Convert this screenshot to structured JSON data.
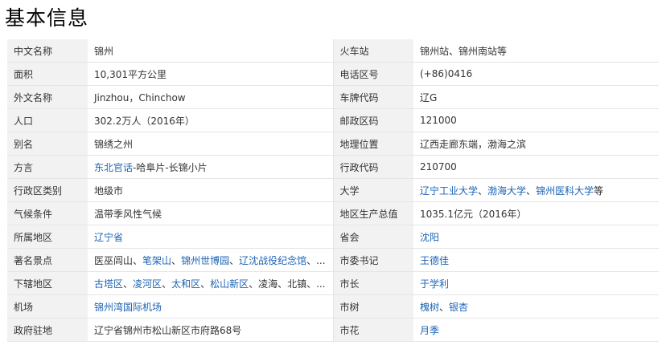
{
  "title": "基本信息",
  "rows": [
    [
      {
        "label": "中文名称",
        "value": [
          {
            "t": "锦州"
          }
        ]
      },
      {
        "label": "火车站",
        "value": [
          {
            "t": "锦州站、锦州南站等"
          }
        ]
      }
    ],
    [
      {
        "label": "面积",
        "value": [
          {
            "t": "10,301平方公里"
          }
        ]
      },
      {
        "label": "电话区号",
        "value": [
          {
            "t": "(+86)0416"
          }
        ]
      }
    ],
    [
      {
        "label": "外文名称",
        "value": [
          {
            "t": "Jinzhou，Chinchow"
          }
        ]
      },
      {
        "label": "车牌代码",
        "value": [
          {
            "t": "辽G"
          }
        ]
      }
    ],
    [
      {
        "label": "人口",
        "value": [
          {
            "t": "302.2万人（2016年）"
          }
        ]
      },
      {
        "label": "邮政区码",
        "value": [
          {
            "t": "121000"
          }
        ]
      }
    ],
    [
      {
        "label": "别名",
        "value": [
          {
            "t": "锦绣之州"
          }
        ]
      },
      {
        "label": "地理位置",
        "value": [
          {
            "t": "辽西走廊东端，渤海之滨"
          }
        ]
      }
    ],
    [
      {
        "label": "方言",
        "value": [
          {
            "t": "东北官话",
            "link": true
          },
          {
            "t": "-哈阜片-长锦小片"
          }
        ]
      },
      {
        "label": "行政代码",
        "value": [
          {
            "t": "210700"
          }
        ]
      }
    ],
    [
      {
        "label": "行政区类别",
        "value": [
          {
            "t": "地级市"
          }
        ]
      },
      {
        "label": "大学",
        "value": [
          {
            "t": "辽宁工业大学",
            "link": true
          },
          {
            "t": "、"
          },
          {
            "t": "渤海大学",
            "link": true
          },
          {
            "t": "、"
          },
          {
            "t": "锦州医科大学",
            "link": true
          },
          {
            "t": "等"
          }
        ]
      }
    ],
    [
      {
        "label": "气候条件",
        "value": [
          {
            "t": "温带季风性气候"
          }
        ]
      },
      {
        "label": "地区生产总值",
        "value": [
          {
            "t": "1035.1亿元（2016年）"
          }
        ]
      }
    ],
    [
      {
        "label": "所属地区",
        "value": [
          {
            "t": "辽宁省",
            "link": true
          }
        ]
      },
      {
        "label": "省会",
        "value": [
          {
            "t": "沈阳",
            "link": true
          }
        ]
      }
    ],
    [
      {
        "label": "著名景点",
        "value": [
          {
            "t": "医巫闾山"
          },
          {
            "t": "、"
          },
          {
            "t": "笔架山",
            "link": true
          },
          {
            "t": "、"
          },
          {
            "t": "锦州世博园",
            "link": true
          },
          {
            "t": "、"
          },
          {
            "t": "辽沈战役纪念馆",
            "link": true
          },
          {
            "t": "、..."
          }
        ]
      },
      {
        "label": "市委书记",
        "value": [
          {
            "t": "王德佳",
            "link": true
          }
        ]
      }
    ],
    [
      {
        "label": "下辖地区",
        "value": [
          {
            "t": "古塔区",
            "link": true
          },
          {
            "t": "、"
          },
          {
            "t": "凌河区",
            "link": true
          },
          {
            "t": "、"
          },
          {
            "t": "太和区",
            "link": true
          },
          {
            "t": "、"
          },
          {
            "t": "松山新区",
            "link": true
          },
          {
            "t": "、凌海、北镇、..."
          }
        ]
      },
      {
        "label": "市长",
        "value": [
          {
            "t": "于学利",
            "link": true
          }
        ]
      }
    ],
    [
      {
        "label": "机场",
        "value": [
          {
            "t": "锦州湾国际机场",
            "link": true
          }
        ]
      },
      {
        "label": "市树",
        "value": [
          {
            "t": "槐树",
            "link": true
          },
          {
            "t": "、"
          },
          {
            "t": "银杏",
            "link": true
          }
        ]
      }
    ],
    [
      {
        "label": "政府驻地",
        "value": [
          {
            "t": "辽宁省锦州市松山新区市府路68号"
          }
        ]
      },
      {
        "label": "市花",
        "value": [
          {
            "t": "月季",
            "link": true
          }
        ]
      }
    ]
  ],
  "colors": {
    "link": "#1c63b4",
    "label_bg": "#f2f2f2",
    "border": "#e5e5e5"
  }
}
